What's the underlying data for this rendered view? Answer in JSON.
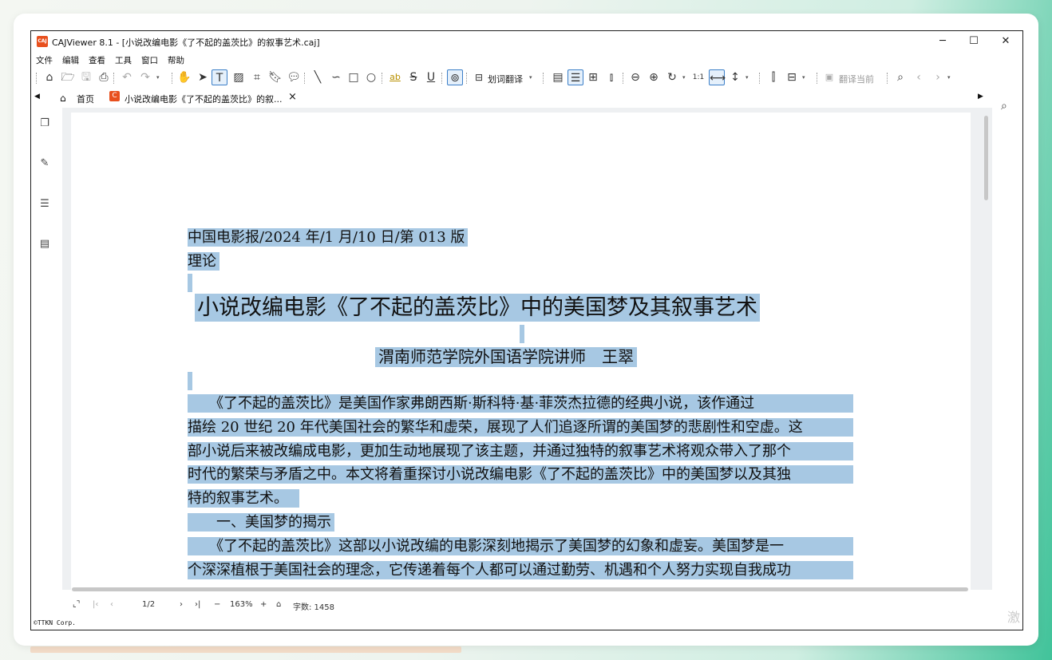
{
  "window": {
    "app_icon_text": "CAJ",
    "title": "CAJViewer 8.1 - [小说改编电影《了不起的盖茨比》的叙事艺术.caj]",
    "minimize": "─",
    "maximize": "☐",
    "close": "✕"
  },
  "menu": [
    "文件",
    "编辑",
    "查看",
    "工具",
    "窗口",
    "帮助"
  ],
  "toolbar": {
    "translate_label": "划词翻译",
    "translate_current_label": "翻译当前"
  },
  "tabs": {
    "home": "首页",
    "document": "小说改编电影《了不起的盖茨比》的叙...",
    "close": "×"
  },
  "document": {
    "header_line1": "中国电影报/2024 年/1 月/10 日/第 013 版",
    "header_line2": "理论",
    "title": "小说改编电影《了不起的盖茨比》中的美国梦及其叙事艺术",
    "author": "渭南师范学院外国语学院讲师　王翠",
    "para1": [
      "　　《了不起的盖茨比》是美国作家弗朗西斯·斯科特·基·菲茨杰拉德的经典小说，该作通过",
      "描绘 20 世纪 20 年代美国社会的繁华和虚荣，展现了人们追逐所谓的美国梦的悲剧性和空虚。这",
      "部小说后来被改编成电影，更加生动地展现了该主题，并通过独特的叙事艺术将观众带入了那个",
      "时代的繁荣与矛盾之中。本文将着重探讨小说改编电影《了不起的盖茨比》中的美国梦以及其独",
      "特的叙事艺术。"
    ],
    "section1": "　　一、美国梦的揭示",
    "para2": [
      "　　《了不起的盖茨比》这部以小说改编的电影深刻地揭示了美国梦的幻象和虚妄。美国梦是一",
      "个深深植根于美国社会的理念，它传递着每个人都可以通过勤劳、机遇和个人努力实现自我成功"
    ]
  },
  "status": {
    "page": "1/2",
    "zoom": "163%",
    "word_count": "字数: 1458"
  },
  "footer": {
    "copyright": "©TTKN Corp.",
    "watermark": "激"
  },
  "colors": {
    "highlight": "#a7c8e3",
    "app_icon": "#e8501e",
    "active_border": "#3c7fc8"
  }
}
